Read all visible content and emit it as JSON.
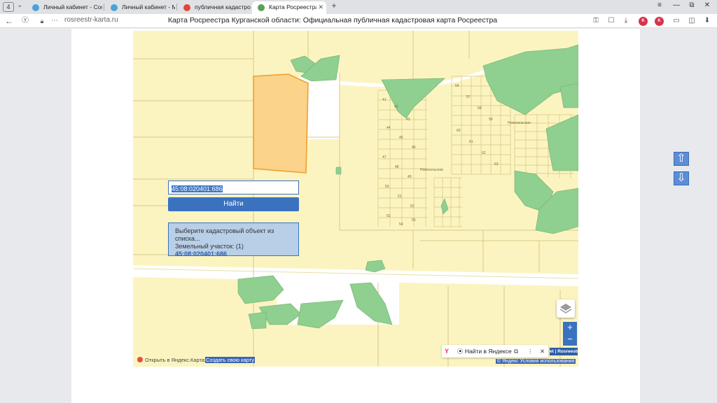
{
  "browser": {
    "tab_count": "4",
    "tabs": [
      {
        "label": "Личный кабинет - Сообщ",
        "favicon_color": "#4aa3d8"
      },
      {
        "label": "Личный кабинет - Мои о",
        "favicon_color": "#4aa3d8"
      },
      {
        "label": "публичная кадастровая к",
        "favicon_color": "#e2453c"
      },
      {
        "label": "Карта Росреестра Курга",
        "favicon_color": "#5aa05a",
        "active": true
      }
    ],
    "url": "rosreestr-karta.ru",
    "page_title": "Карта Росреестра Курганской области: Официальная публичная кадастровая карта Росреестра",
    "icons": [
      "back-icon",
      "yandex-protect-icon",
      "lock-icon",
      "bookmark-icon",
      "download-icon",
      "extension-icons",
      "menu-icon",
      "minimize-icon",
      "restore-icon",
      "close-icon"
    ]
  },
  "map": {
    "search_value": "45:08:020401:686",
    "find_label": "Найти",
    "result_prompt": "Выберите кадастровый объект из списка...",
    "result_category": "Земельный участок: (1)",
    "result_number": "45:08:020401:686",
    "up_arrow": "⇧",
    "down_arrow": "⇩",
    "zoom_in": "+",
    "zoom_out": "−",
    "yandex_find": "Найти в Яндексе",
    "rosreestr_badge": "et | Rosreestr",
    "open_in_yandex": "Открыть в Яндекс.Картах",
    "create_map": "Создать свою карту",
    "terms": "© Яндекс Условия использования",
    "parcel_labels": [
      "41",
      "42",
      "43",
      "44",
      "45",
      "46",
      "47",
      "48",
      "49",
      "50",
      "51",
      "52",
      "53",
      "54",
      "55",
      "56",
      "57",
      "58",
      "59",
      "60",
      "61",
      "62",
      "63",
      "Новосельская",
      "Новосельская"
    ],
    "colors": {
      "map_bg": "#fcf4c0",
      "parcel_line": "#d8c98a",
      "forest": "#8fcf8f",
      "selected_parcel": "#fbd38a",
      "selected_border": "#f0a030",
      "accent": "#3b72c0"
    }
  }
}
